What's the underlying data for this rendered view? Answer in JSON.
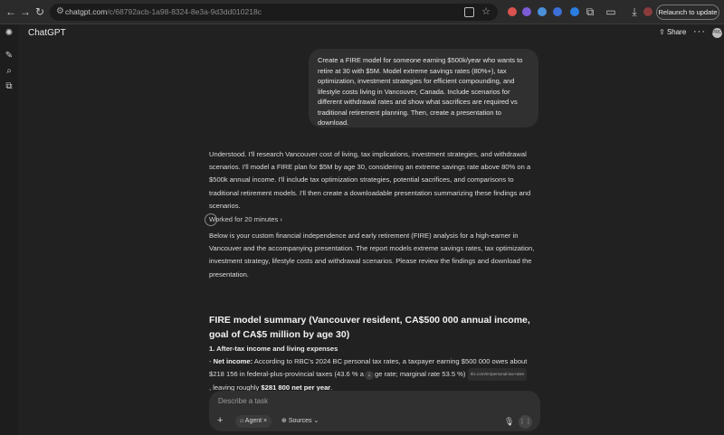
{
  "browser": {
    "url_host": "chatgpt.com",
    "url_path": "/c/68792acb-1a98-8324-8e3a-9d3dd010218c",
    "relaunch_label": "Relaunch to update"
  },
  "header": {
    "title": "ChatGPT",
    "share_label": "Share",
    "more_label": "···",
    "avatar_text": "PRO"
  },
  "user_message": "Create a FIRE model for someone earning $500k/year who wants to retire at 30 with $5M. Model extreme savings rates (80%+), tax optimization, investment strategies for efficient compounding, and lifestyle costs living in Vancouver, Canada. Include scenarios for different withdrawal rates and show what sacrifices are required vs traditional retirement planning. Then, create a presentation to download.",
  "assistant": {
    "intro": "Understood. I'll research Vancouver cost of living, tax implications, investment strategies, and withdrawal scenarios. I'll model a FIRE plan for $5M by age 30, considering an extreme savings rate above 80% on a $500k annual income. I'll include tax optimization strategies, potential sacrifices, and comparisons to traditional retirement models. I'll then create a downloadable presentation summarizing these findings and scenarios.",
    "worked_label": "Worked for 20 minutes",
    "result_intro": "Below is your custom financial independence and early retirement (FIRE) analysis for a high-earner in Vancouver and the accompanying presentation. The report models extreme savings rates, tax optimization, investment strategy, lifestyle costs and withdrawal scenarios. Please review the findings and download the presentation.",
    "summary_heading": "FIRE model summary (Vancouver resident, CA$500 000 annual income, goal of CA$5 million by age 30)",
    "section1_heading": "1. After-tax income and living expenses",
    "net_income_label": "Net income:",
    "net_income_text_a": " According to RBC's 2024 BC personal tax rates, a taxpayer earning $500 000 owes about $218 156 in federal-plus-provincial taxes (43.6 % a",
    "net_income_text_b": "ge rate; marginal rate 53.5 %)",
    "citation_chip": "rbc.com/en/personal-tax-rates",
    "net_income_text_c": ", leaving roughly ",
    "net_income_bold": "$281 800 net per year",
    "net_income_end": "."
  },
  "composer": {
    "placeholder": "Describe a task",
    "agent_label": "Agent",
    "sources_label": "Sources"
  }
}
